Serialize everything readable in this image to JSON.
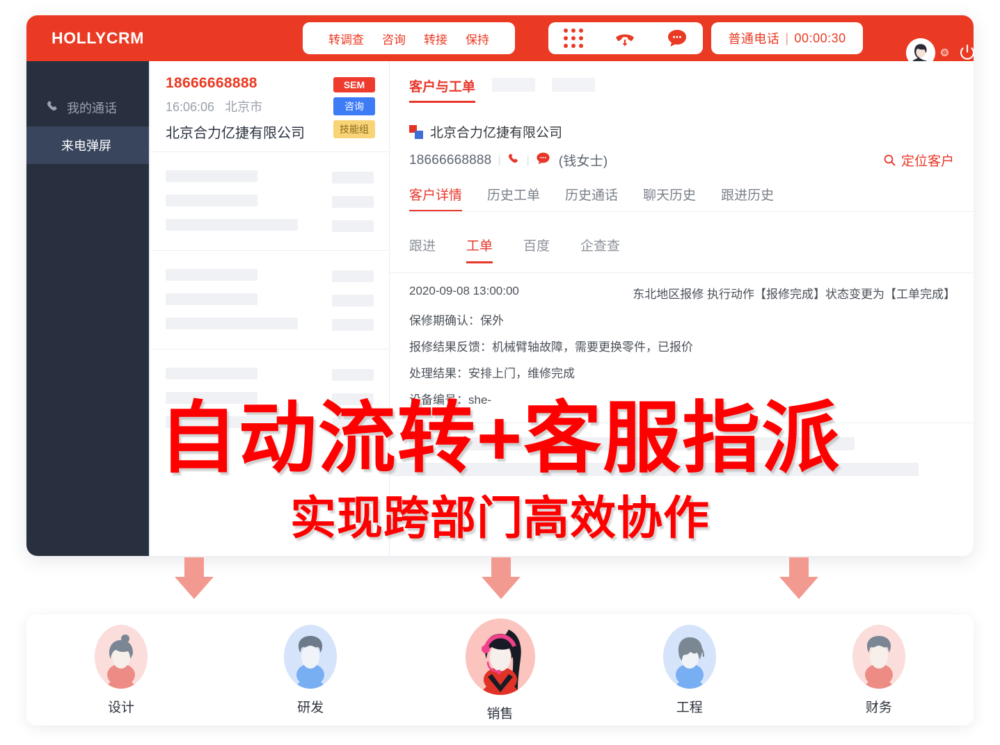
{
  "brand": "HOLLYCRM",
  "topbar": {
    "actions": [
      "转调查",
      "咨询",
      "转接",
      "保持"
    ],
    "call_icons": [
      "dialpad-icon",
      "hangup-icon",
      "message-icon"
    ],
    "status_label": "普通电话",
    "status_separator": "|",
    "status_timer": "00:00:30",
    "avatar": "user-avatar",
    "power": "power-icon"
  },
  "sidebar": {
    "items": [
      {
        "label": "我的通话",
        "icon": "phone-icon",
        "active": false
      },
      {
        "label": "来电弹屏",
        "icon": "",
        "active": true
      }
    ]
  },
  "contact": {
    "phone": "18666668888",
    "time": "16:06:06",
    "city": "北京市",
    "company": "北京合力亿捷有限公司",
    "tags": [
      "SEM",
      "咨询",
      "技能组"
    ]
  },
  "detail": {
    "main_tab": "客户与工单",
    "company": "北京合力亿捷有限公司",
    "phone": "18666668888",
    "contact_name": "(钱女士)",
    "locate_label": "定位客户",
    "locate_icon": "search-icon",
    "phone_icon": "phone-icon",
    "chat_icon": "chat-bubble-icon",
    "tabs": [
      {
        "label": "客户详情",
        "active": true
      },
      {
        "label": "历史工单",
        "active": false
      },
      {
        "label": "历史通话",
        "active": false
      },
      {
        "label": "聊天历史",
        "active": false
      },
      {
        "label": "跟进历史",
        "active": false
      }
    ],
    "mini_tabs": [
      {
        "label": "跟进",
        "active": false
      },
      {
        "label": "工单",
        "active": true
      },
      {
        "label": "百度",
        "active": false
      },
      {
        "label": "企查查",
        "active": false
      }
    ],
    "ticket": {
      "timestamp": "2020-09-08 13:00:00",
      "action": "东北地区报修 执行动作【报修完成】状态变更为【工单完成】",
      "lines": [
        "保修期确认：保外",
        "报修结果反馈：机械臂轴故障，需要更换零件，已报价",
        "处理结果：安排上门，维修完成",
        "设备编号：she-"
      ]
    }
  },
  "overlay": {
    "line1": "自动流转+客服指派",
    "line2": "实现跨部门高效协作",
    "color": "#FF0000"
  },
  "departments": [
    {
      "label": "设计",
      "bg": "#FBDEDC",
      "body": "#EC8C84",
      "hair": "#7B8695"
    },
    {
      "label": "研发",
      "bg": "#D6E4FB",
      "body": "#78AEF2",
      "hair": "#6D7A8A"
    },
    {
      "label": "销售",
      "bg": "#FBC4BE",
      "body": "#E03226",
      "hair": "#181B24"
    },
    {
      "label": "工程",
      "bg": "#D6E4FB",
      "body": "#78AEF2",
      "hair": "#7C8794"
    },
    {
      "label": "财务",
      "bg": "#FBDEDC",
      "body": "#EC8C84",
      "hair": "#7B8695"
    }
  ],
  "colors": {
    "brand_red": "#EA3A23",
    "sidebar_dark": "#28303F",
    "sidebar_active": "#39455C",
    "arrow": "#F29A90"
  }
}
